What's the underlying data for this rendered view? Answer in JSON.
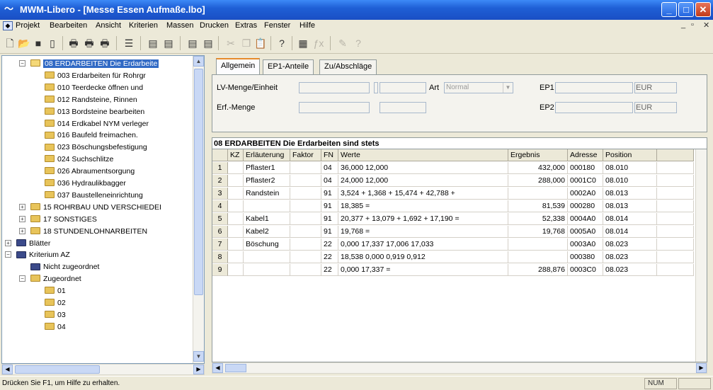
{
  "window": {
    "title": "MWM-Libero - [Messe Essen Aufmaße.lbo]"
  },
  "menu": [
    "Projekt",
    "Bearbeiten",
    "Ansicht",
    "Kriterien",
    "Massen",
    "Drucken",
    "Extras",
    "Fenster",
    "Hilfe"
  ],
  "toolbar_icons": [
    "new-doc-icon",
    "open-folder-icon",
    "save-icon",
    "page-icon",
    "print-icon",
    "print-preview-icon",
    "print-setup-icon",
    "list-icon",
    "calc-icon",
    "calc2-icon",
    "calc3-icon",
    "calc4-icon",
    "cut-icon",
    "copy-icon",
    "paste-icon",
    "help-icon",
    "table-icon",
    "formula-icon",
    "tool-icon",
    "whatsthis-icon"
  ],
  "tree": {
    "items": [
      {
        "label": "08 ERDARBEITEN Die Erdarbeite",
        "level": 1,
        "expander": "−",
        "selected": true
      },
      {
        "label": "003  Erdarbeiten für Rohrgr",
        "level": 2
      },
      {
        "label": "010  Teerdecke öffnen und",
        "level": 2
      },
      {
        "label": "012  Randsteine, Rinnen",
        "level": 2
      },
      {
        "label": "013  Bordsteine bearbeiten",
        "level": 2
      },
      {
        "label": "014  Erdkabel NYM verleger",
        "level": 2
      },
      {
        "label": "016  Baufeld freimachen.",
        "level": 2
      },
      {
        "label": "023  Böschungsbefestigung",
        "level": 2
      },
      {
        "label": "024  Suchschlitze",
        "level": 2
      },
      {
        "label": "026  Abraumentsorgung",
        "level": 2
      },
      {
        "label": "036  Hydraulikbagger",
        "level": 2
      },
      {
        "label": "037  Baustelleneinrichtung",
        "level": 2
      },
      {
        "label": "15 ROHRBAU UND VERSCHIEDEI",
        "level": 1,
        "expander": "+"
      },
      {
        "label": "17 SONSTIGES",
        "level": 1,
        "expander": "+"
      },
      {
        "label": "18 STUNDENLOHNARBEITEN",
        "level": 1,
        "expander": "+"
      },
      {
        "label": "Blätter",
        "level": 0,
        "expander": "+",
        "dark": true
      },
      {
        "label": "Kriterium AZ",
        "level": 0,
        "expander": "−",
        "dark": true
      },
      {
        "label": "Nicht zugeordnet",
        "level": 1,
        "dark": true
      },
      {
        "label": "Zugeordnet",
        "level": 1,
        "expander": "−"
      },
      {
        "label": "01",
        "level": 2
      },
      {
        "label": "02",
        "level": 2
      },
      {
        "label": "03",
        "level": 2
      },
      {
        "label": "04",
        "level": 2
      }
    ]
  },
  "tabs": [
    "Allgemein",
    "EP1-Anteile",
    "Zu/Abschläge"
  ],
  "form": {
    "lv_menge_label": "LV-Menge/Einheit",
    "erf_menge_label": "Erf.-Menge",
    "art_label": "Art",
    "art_value": "Normal",
    "ep1_label": "EP1",
    "ep2_label": "EP2",
    "currency1": "EUR",
    "currency2": "EUR"
  },
  "grid": {
    "title": "08  ERDARBEITEN Die Erdarbeiten sind stets",
    "columns": [
      "KZ",
      "Erläuterung",
      "Faktor",
      "FN",
      "Werte",
      "Ergebnis",
      "Adresse",
      "Position"
    ],
    "rows": [
      {
        "n": "1",
        "kz": "",
        "erl": "Pflaster1",
        "faktor": "",
        "fn": "04",
        "werte": "36,000 12,000",
        "ergebnis": "432,000",
        "adresse": "000180",
        "position": "08.010"
      },
      {
        "n": "2",
        "kz": "",
        "erl": "Pflaster2",
        "faktor": "",
        "fn": "04",
        "werte": "24,000 12,000",
        "ergebnis": "288,000",
        "adresse": "0001C0",
        "position": "08.010"
      },
      {
        "n": "3",
        "kz": "",
        "erl": "Randstein",
        "faktor": "",
        "fn": "91",
        "werte": "3,524 + 1,368 + 15,474 + 42,788 +",
        "ergebnis": "",
        "adresse": "0002A0",
        "position": "08.013"
      },
      {
        "n": "4",
        "kz": "",
        "erl": "",
        "faktor": "",
        "fn": "91",
        "werte": "18,385 =",
        "ergebnis": "81,539",
        "adresse": "000280",
        "position": "08.013"
      },
      {
        "n": "5",
        "kz": "",
        "erl": "Kabel1",
        "faktor": "",
        "fn": "91",
        "werte": "20,377 + 13,079 + 1,692 + 17,190 =",
        "ergebnis": "52,338",
        "adresse": "0004A0",
        "position": "08.014"
      },
      {
        "n": "6",
        "kz": "",
        "erl": "Kabel2",
        "faktor": "",
        "fn": "91",
        "werte": "19,768 =",
        "ergebnis": "19,768",
        "adresse": "0005A0",
        "position": "08.014"
      },
      {
        "n": "7",
        "kz": "",
        "erl": "Böschung",
        "faktor": "",
        "fn": "22",
        "werte": "0,000 17,337 17,006 17,033",
        "ergebnis": "",
        "adresse": "0003A0",
        "position": "08.023"
      },
      {
        "n": "8",
        "kz": "",
        "erl": "",
        "faktor": "",
        "fn": "22",
        "werte": "18,538 0,000 0,919 0,912",
        "ergebnis": "",
        "adresse": "000380",
        "position": "08.023"
      },
      {
        "n": "9",
        "kz": "",
        "erl": "",
        "faktor": "",
        "fn": "22",
        "werte": "0,000 17,337 =",
        "ergebnis": "288,876",
        "adresse": "0003C0",
        "position": "08.023"
      }
    ]
  },
  "status": {
    "text": "Drücken Sie F1, um Hilfe zu erhalten.",
    "num": "NUM"
  }
}
